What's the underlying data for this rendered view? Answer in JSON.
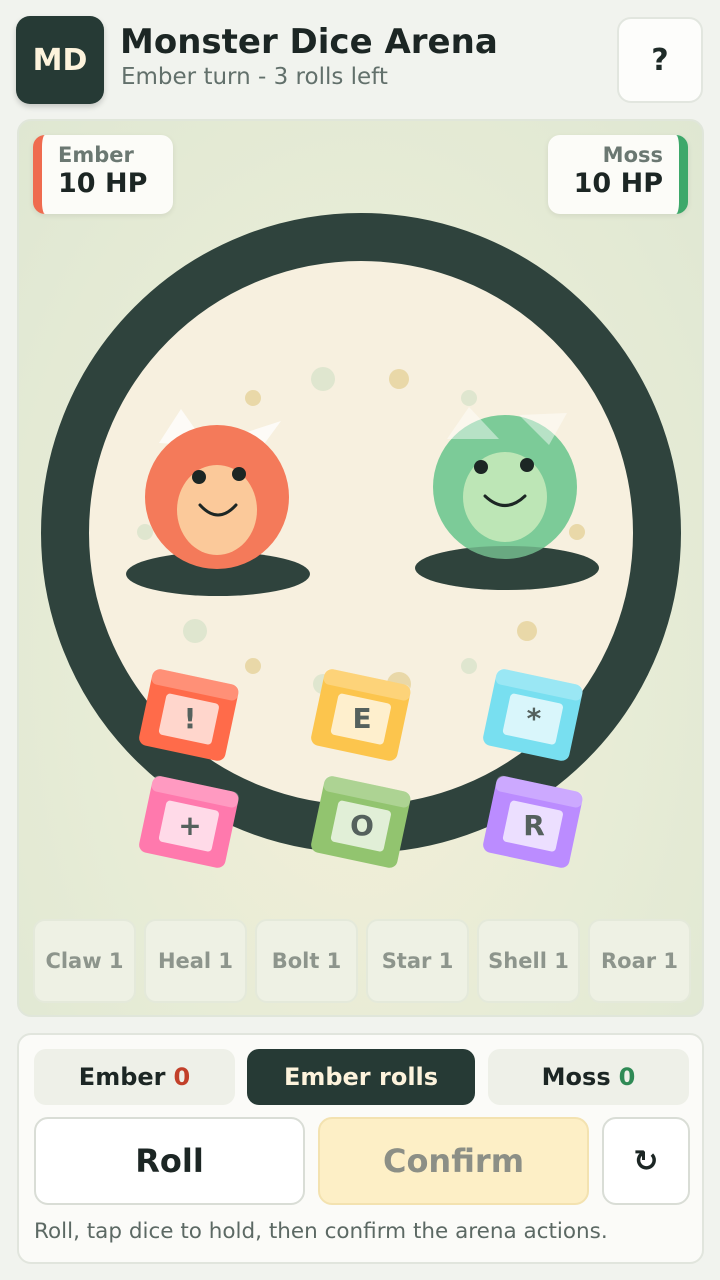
{
  "header": {
    "logo": "MD",
    "title": "Monster Dice Arena",
    "subtitle": "Ember turn - 3 rolls left",
    "help_label": "?"
  },
  "players": {
    "ember": {
      "name": "Ember",
      "hp": "10 HP",
      "color": "#ef6b4f"
    },
    "moss": {
      "name": "Moss",
      "hp": "10 HP",
      "color": "#3da86a"
    }
  },
  "monsters": {
    "ember": {
      "body_color": "#f47a5a",
      "face_color": "#fbc99a"
    },
    "moss": {
      "body_color": "#7ccb98",
      "face_color": "#bde6b6"
    }
  },
  "dice": [
    {
      "face": "!",
      "color": "#ff6b4a"
    },
    {
      "face": "E",
      "color": "#fcc54d"
    },
    {
      "face": "*",
      "color": "#78dff0"
    },
    {
      "face": "+",
      "color": "#ff79ad"
    },
    {
      "face": "O",
      "color": "#92c46f"
    },
    {
      "face": "R",
      "color": "#bb8cff"
    }
  ],
  "moves": [
    "Claw 1",
    "Heal 1",
    "Bolt 1",
    "Star 1",
    "Shell 1",
    "Roar 1"
  ],
  "score": {
    "ember_label": "Ember",
    "ember_value": "0",
    "turn_label": "Ember rolls",
    "moss_label": "Moss",
    "moss_value": "0"
  },
  "actions": {
    "roll": "Roll",
    "confirm": "Confirm",
    "reset": "↻"
  },
  "hint": "Roll, tap dice to hold, then confirm the arena actions.",
  "colors": {
    "dark": "#263a35",
    "arena_floor": "#f7f0df",
    "ring": "#2f433d"
  }
}
